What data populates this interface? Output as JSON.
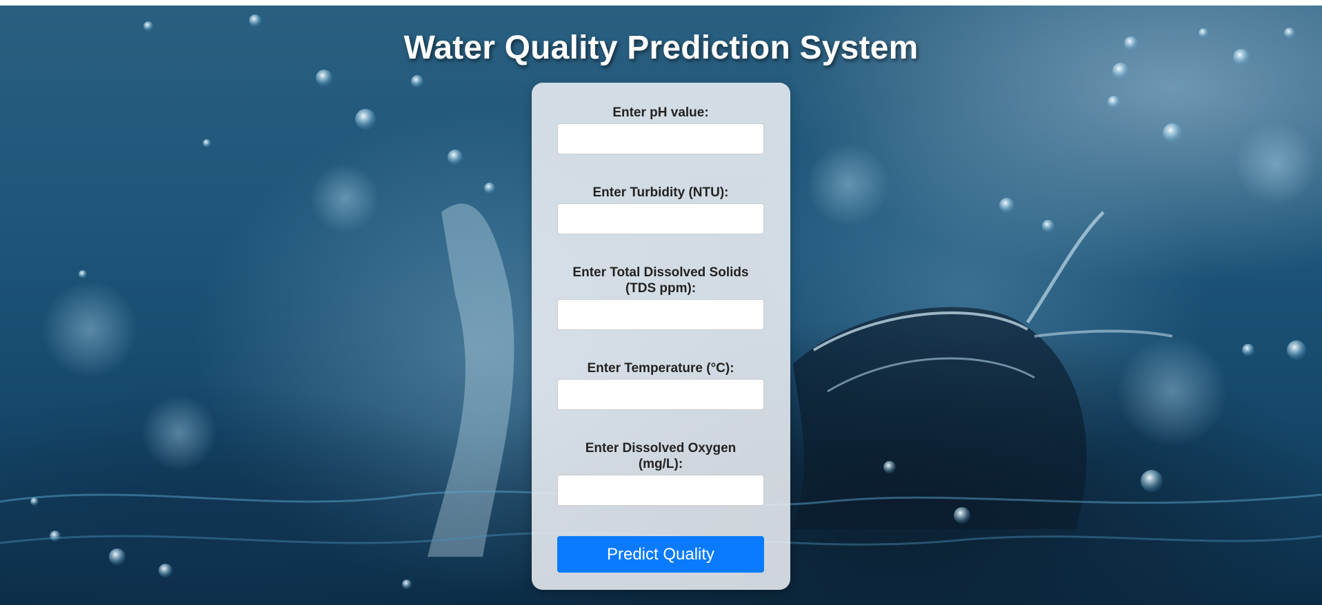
{
  "page": {
    "title": "Water Quality Prediction System"
  },
  "form": {
    "fields": [
      {
        "label": "Enter pH value:",
        "value": "",
        "placeholder": ""
      },
      {
        "label": "Enter Turbidity (NTU):",
        "value": "",
        "placeholder": ""
      },
      {
        "label": "Enter Total Dissolved Solids (TDS ppm):",
        "value": "",
        "placeholder": ""
      },
      {
        "label": "Enter Temperature (°C):",
        "value": "",
        "placeholder": ""
      },
      {
        "label": "Enter Dissolved Oxygen (mg/L):",
        "value": "",
        "placeholder": ""
      }
    ],
    "submit_label": "Predict Quality"
  },
  "colors": {
    "button": "#0a7bff",
    "card": "#ebeef2",
    "title": "#ffffff"
  },
  "icons": {
    "background": "water-splash-background-image"
  }
}
